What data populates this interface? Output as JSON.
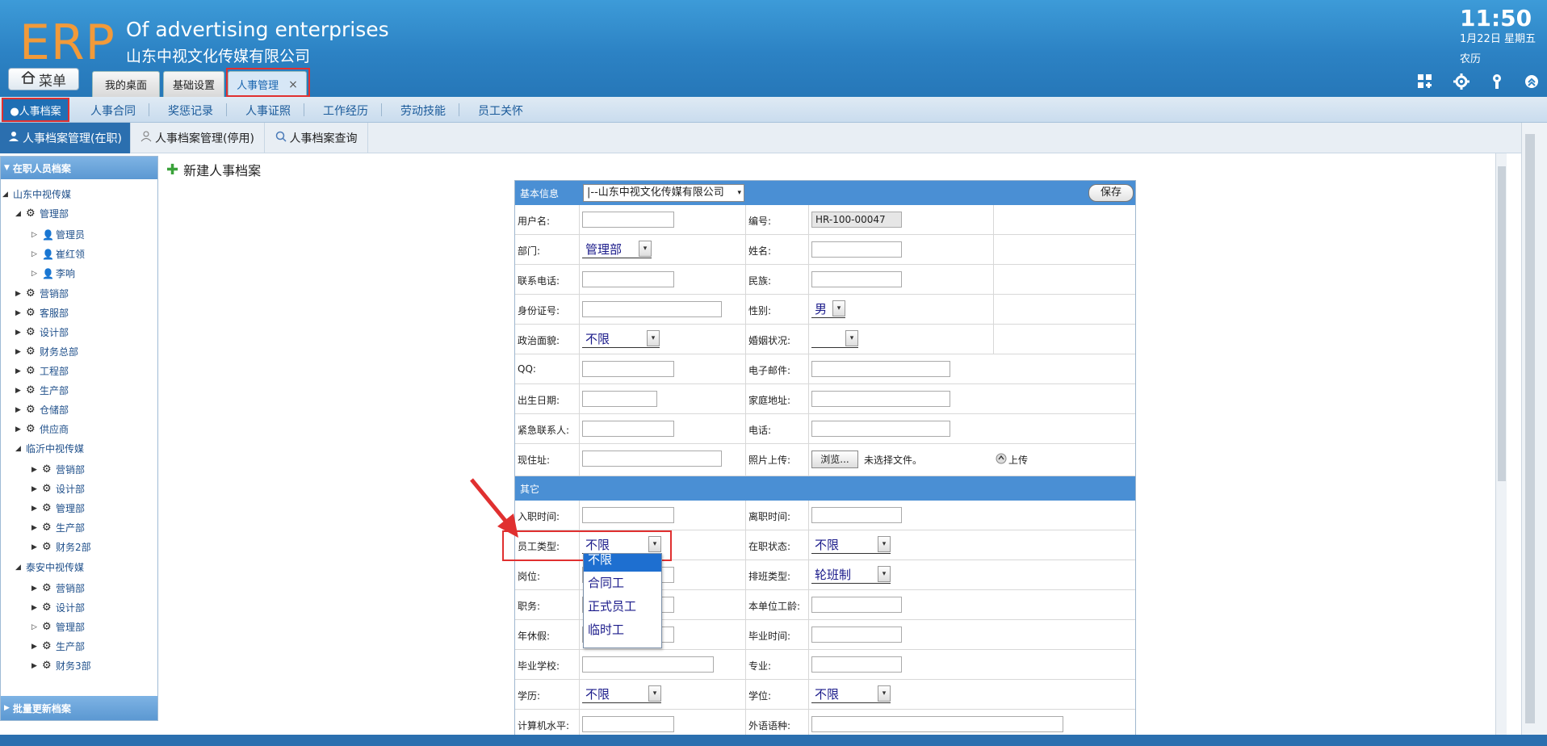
{
  "header": {
    "logo": "ERP",
    "brand_en": "Of advertising enterprises",
    "brand_cn": "山东中视文化传媒有限公司",
    "clock": "11:50",
    "date": "1月22日 星期五",
    "lunar": "农历",
    "menu_label": "菜单",
    "tabs": [
      {
        "label": "我的桌面"
      },
      {
        "label": "基础设置"
      },
      {
        "label": "人事管理",
        "close": "×"
      }
    ],
    "icons": [
      "apps-icon",
      "settings-icon",
      "key-icon",
      "collapse-icon"
    ]
  },
  "subnav": {
    "active": "●人事档案",
    "items": [
      "人事合同",
      "奖惩记录",
      "人事证照",
      "工作经历",
      "劳动技能",
      "员工关怀"
    ]
  },
  "module_tabs": [
    {
      "label": "人事档案管理(在职)",
      "active": true
    },
    {
      "label": "人事档案管理(停用)",
      "active": false
    },
    {
      "label": "人事档案查询",
      "active": false
    }
  ],
  "tree": {
    "header": "在职人员档案",
    "footer": "批量更新档案",
    "nodes": [
      {
        "label": "山东中视传媒"
      },
      {
        "label": "管理部"
      },
      {
        "label": "管理员"
      },
      {
        "label": "崔红领"
      },
      {
        "label": "李响"
      },
      {
        "label": "营销部"
      },
      {
        "label": "客服部"
      },
      {
        "label": "设计部"
      },
      {
        "label": "财务总部"
      },
      {
        "label": "工程部"
      },
      {
        "label": "生产部"
      },
      {
        "label": "仓储部"
      },
      {
        "label": "供应商"
      },
      {
        "label": "临沂中视传媒"
      },
      {
        "label": "营销部"
      },
      {
        "label": "设计部"
      },
      {
        "label": "管理部"
      },
      {
        "label": "生产部"
      },
      {
        "label": "财务2部"
      },
      {
        "label": "泰安中视传媒"
      },
      {
        "label": "营销部"
      },
      {
        "label": "设计部"
      },
      {
        "label": "管理部"
      },
      {
        "label": "生产部"
      },
      {
        "label": "财务3部"
      }
    ]
  },
  "page": {
    "title": "新建人事档案"
  },
  "form": {
    "basic_section": "基本信息",
    "company_select": "|--山东中视文化传媒有限公司",
    "save": "保存",
    "other_section": "其它",
    "labels": {
      "username": "用户名:",
      "code": "编号:",
      "dept": "部门:",
      "name": "姓名:",
      "phone": "联系电话:",
      "nation": "民族:",
      "idcard": "身份证号:",
      "gender": "性别:",
      "politics": "政治面貌:",
      "marriage": "婚姻状况:",
      "qq": "QQ:",
      "email": "电子邮件:",
      "birthday": "出生日期:",
      "address": "家庭地址:",
      "emergency": "紧急联系人:",
      "tel": "电话:",
      "current_addr": "现住址:",
      "photo": "照片上传:",
      "entry_date": "入职时间:",
      "leave_date": "离职时间:",
      "emp_type": "员工类型:",
      "status": "在职状态:",
      "post": "岗位:",
      "shift": "排班类型:",
      "duty": "职务:",
      "seniority": "本单位工龄:",
      "annual_leave": "年休假:",
      "grad_date": "毕业时间:",
      "school": "毕业学校:",
      "major": "专业:",
      "education": "学历:",
      "degree": "学位:",
      "computer": "计算机水平:",
      "language": "外语语种:"
    },
    "values": {
      "code": "HR-100-00047",
      "dept": "管理部",
      "gender": "男",
      "politics": "不限",
      "emp_type": "不限",
      "status": "不限",
      "shift": "轮班制",
      "education": "不限",
      "degree": "不限",
      "browse": "浏览...",
      "no_file": "未选择文件。",
      "upload": "上传"
    },
    "emp_type_options": [
      "不限",
      "合同工",
      "正式员工",
      "临时工"
    ]
  },
  "colors": {
    "header_blue": "#2c82c4",
    "logo_orange": "#f19a3a",
    "highlight_red": "#e03030",
    "section_blue": "#4a8fd4"
  }
}
